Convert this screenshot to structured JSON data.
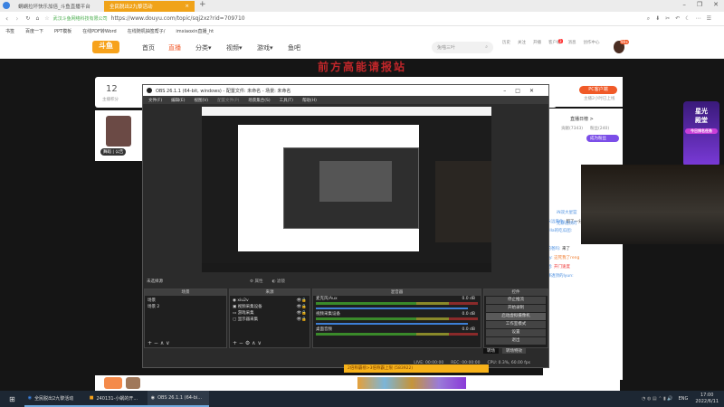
{
  "browser": {
    "tabs": [
      {
        "label": "蜗蜗拉坏快乐加倍_斗鱼直播平台"
      },
      {
        "label": "全民脱出2九黎活动",
        "active": true
      }
    ],
    "address": {
      "site_label": "武汉斗鱼网络科技有限公司",
      "url": "https://www.douyu.com/topic/sqj2xz?rid=709710"
    },
    "bookmarks": [
      "书签",
      "百度一下",
      "PPT模板",
      "在线PDF转Word",
      "在线随机抽签帮子/",
      "imxiaoxin直播_ht"
    ]
  },
  "site": {
    "logo": "斗鱼",
    "nav": [
      "首页",
      "直播",
      "分类▾",
      "视频▾",
      "游戏▾",
      "鱼吧"
    ],
    "search_placeholder": "兔喵三叶",
    "icons": [
      "历史",
      "关注",
      "开播",
      "客户端",
      "消息",
      "创作中心"
    ],
    "notification_badge": "3",
    "avatar_badge": "99+",
    "banner": "前方高能请报站",
    "level": "12",
    "level_label": "主播积分",
    "anchor_tags": [
      "舞蹈",
      "公告"
    ],
    "pc_client": "PC客户端",
    "pc_sub": "主播2小时已上线",
    "rank_title": "直播日榜 >",
    "rank_tabs": [
      "贡献(7343)",
      "粉丝(240)"
    ],
    "become_fan": "成为粉丝",
    "activity_badge": [
      "星光",
      "殿堂",
      "今日排名任务"
    ],
    "chat": [
      {
        "user": "iN双大星篮",
        "text": ""
      },
      {
        "user": "无聊透顶的",
        "text": ""
      },
      {
        "user": "我永远爱你:",
        "text": "超了一分钟了"
      },
      {
        "user": "Stella的吃瓜团:",
        "text": ""
      },
      {
        "user": "我的爸吗:",
        "text": "来了"
      },
      {
        "user": "Joey:",
        "text": "这死我了reng"
      },
      {
        "user": "字团:",
        "text": "开门速度"
      },
      {
        "user": "无聊透顶的lyun:",
        "text": ""
      }
    ],
    "gift_notice": "2倍称霸榜>3倍称霸上限 (583922)"
  },
  "obs": {
    "title": "OBS 26.1.1 (64-bit, windows) - 配置文件: 未命名 - 场景: 未命名",
    "menu": [
      "文件(F)",
      "编辑(E)",
      "视图(V)",
      "配置文件(P)",
      "场景集合(S)",
      "工具(T)",
      "帮助(H)"
    ],
    "no_source": "未选择源",
    "props": "属性",
    "filters": "滤镜",
    "panels": {
      "scenes": "场景",
      "sources": "来源",
      "mixer": "混音器",
      "controls": "控件"
    },
    "scenes": [
      "场景",
      "场景 2"
    ],
    "sources": [
      "xiu2v",
      "视频采集设备",
      "游戏采集",
      "显示器采集"
    ],
    "mixer": [
      {
        "name": "麦克风/Aux",
        "db": "0.0 dB"
      },
      {
        "name": "视频采集设备",
        "db": "0.0 dB"
      },
      {
        "name": "桌面音频",
        "db": "0.0 dB"
      }
    ],
    "controls": [
      "停止推流",
      "开始录制",
      "启动虚拟摄像机",
      "工作室模式",
      "设置",
      "退出"
    ],
    "transition": [
      "转场",
      "转场特效"
    ],
    "status": {
      "live": "LIVE: 00:00:00",
      "rec": "REC: 00:00:00",
      "cpu": "CPU: 0.3%, 60.00 fps"
    }
  },
  "taskbar": {
    "items": [
      "全民脱出2九黎活动",
      "240131-小蜗的开...",
      "OBS 26.1.1 (64-bi..."
    ],
    "lang": "ENG",
    "time": "17:00",
    "date": "2022/6/11"
  }
}
